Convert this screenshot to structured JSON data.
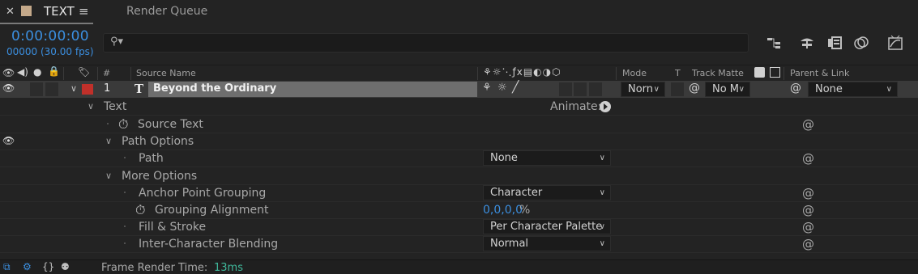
{
  "tabs": {
    "close_glyph": "✕",
    "active_label": "TEXT",
    "menu_glyph": "≡",
    "inactive_label": "Render Queue",
    "swatch_color": "#c4a98a"
  },
  "timecode": {
    "value": "0:00:00:00",
    "frames": "00000 (30.00 fps)"
  },
  "search": {
    "icon": "⚲▾",
    "placeholder": ""
  },
  "toolbar_icons": [
    "flowchart-icon",
    "draft-3d-icon",
    "frame-blending-icon",
    "motion-blur-icon",
    "graph-editor-icon"
  ],
  "columns": {
    "hash": "#",
    "source_name": "Source Name",
    "mode": "Mode",
    "t": "T",
    "track_matte": "Track Matte",
    "parent_link": "Parent & Link"
  },
  "layer": {
    "index": "1",
    "type_glyph": "T",
    "name": "Beyond the Ordinary",
    "label_color": "#c0302a",
    "mode": "Norn",
    "track_matte": "No M",
    "parent": "None"
  },
  "properties": {
    "text_group": "Text",
    "animate_label": "Animate:",
    "source_text": "Source Text",
    "path_options": "Path Options",
    "path": "Path",
    "path_value": "None",
    "more_options": "More Options",
    "anchor_point_grouping": "Anchor Point Grouping",
    "anchor_point_grouping_value": "Character",
    "grouping_alignment": "Grouping Alignment",
    "grouping_alignment_value": "0,0,0,0",
    "grouping_alignment_unit": "%",
    "fill_stroke": "Fill & Stroke",
    "fill_stroke_value": "Per Character Palette",
    "inter_character_blending": "Inter-Character Blending",
    "inter_character_blending_value": "Normal"
  },
  "footer": {
    "label": "Frame Render Time:",
    "value": "13ms"
  }
}
